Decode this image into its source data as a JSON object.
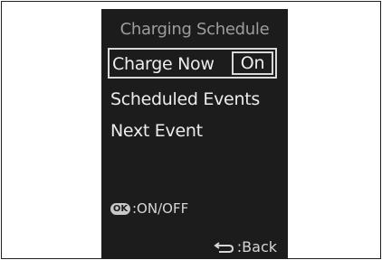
{
  "screen": {
    "title": "Charging Schedule",
    "items": [
      {
        "label": "Charge Now",
        "value": "On"
      },
      {
        "label": "Scheduled Events"
      },
      {
        "label": "Next Event"
      }
    ],
    "hint": {
      "button": "OK",
      "text": ":ON/OFF"
    },
    "back": {
      "icon": "back-arrow-icon",
      "text": ":Back"
    }
  },
  "colors": {
    "screen_bg": "#1c1c1c",
    "title": "#9d9d9d",
    "text": "#ececec",
    "border": "#d8d8d8"
  }
}
